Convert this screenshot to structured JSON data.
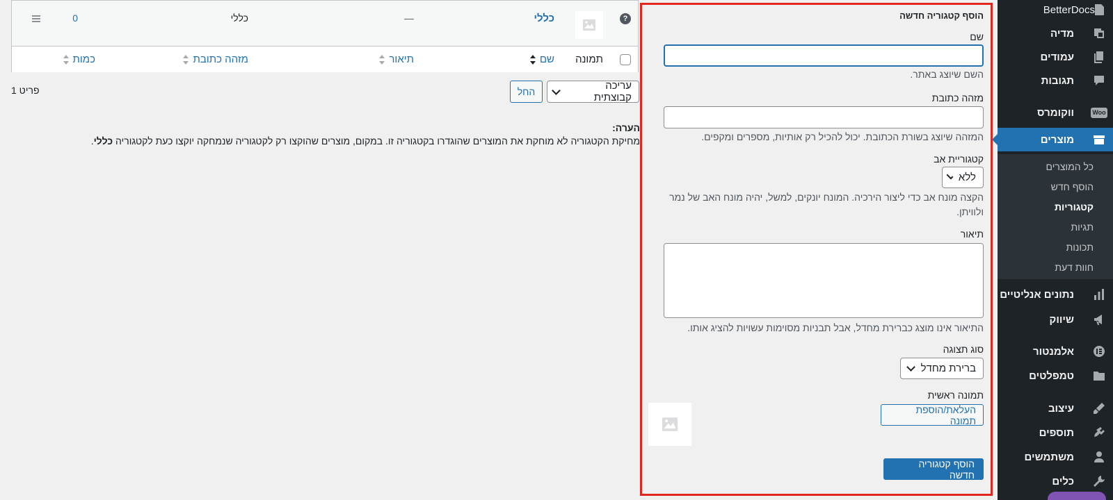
{
  "sidebar": {
    "items": [
      {
        "label": "BetterDocs",
        "icon": "docs-icon"
      },
      {
        "label": "מדיה",
        "icon": "media-icon"
      },
      {
        "label": "עמודים",
        "icon": "pages-icon"
      },
      {
        "label": "תגובות",
        "icon": "comments-icon"
      },
      {
        "label": "ווקומרס",
        "icon": "woocommerce-icon",
        "badge": "Woo"
      },
      {
        "label": "מוצרים",
        "icon": "products-icon",
        "active": true
      },
      {
        "label": "נתונים אנליטיים",
        "icon": "analytics-icon"
      },
      {
        "label": "שיווק",
        "icon": "marketing-icon"
      },
      {
        "label": "אלמנטור",
        "icon": "elementor-icon"
      },
      {
        "label": "טמפלטים",
        "icon": "templates-icon"
      },
      {
        "label": "עיצוב",
        "icon": "appearance-icon"
      },
      {
        "label": "תוספים",
        "icon": "plugins-icon"
      },
      {
        "label": "משתמשים",
        "icon": "users-icon"
      },
      {
        "label": "כלים",
        "icon": "tools-icon"
      }
    ],
    "submenu": [
      {
        "label": "כל המוצרים"
      },
      {
        "label": "הוסף חדש"
      },
      {
        "label": "קטגוריות",
        "current": true
      },
      {
        "label": "תגיות"
      },
      {
        "label": "תכונות"
      },
      {
        "label": "חוות דעת"
      }
    ]
  },
  "form": {
    "title": "הוסף קטגוריה חדשה",
    "name_label": "שם",
    "name_value": "",
    "name_help": "השם שיוצג באתר.",
    "slug_label": "מזהה כתובת",
    "slug_value": "",
    "slug_help": "המזהה שיוצג בשורת הכתובת. יכול להכיל רק אותיות, מספרים ומקפים.",
    "parent_label": "קטגוריית אב",
    "parent_value": "ללא",
    "parent_help_1": "הקצה מונח אב כדי ליצור הירכיה. המונח יונקים, למשל, יהיה מונח האב של נמר",
    "parent_help_2": "ולוויתן.",
    "description_label": "תיאור",
    "description_help": "התיאור אינו מוצג כברירת מחדל, אבל תבניות מסוימות עשויות להציג אותו.",
    "display_type_label": "סוג תצוגה",
    "display_type_value": "ברירת מחדל",
    "thumbnail_label": "תמונה ראשית",
    "upload_button": "העלאת/הוספת תמונה",
    "submit_button": "הוסף קטגוריה חדשה"
  },
  "table": {
    "row": {
      "name": "כללי",
      "description": "—",
      "slug": "כללי",
      "count": "0"
    },
    "headers": {
      "image": "תמונה",
      "name": "שם",
      "description": "תיאור",
      "slug": "מזהה כתובת",
      "count": "כמות"
    }
  },
  "bulk": {
    "action_value": "עריכה קבוצתית",
    "apply_button": "החל",
    "items_count": "פריט 1"
  },
  "note": {
    "title": "הערה:",
    "text_before": "מחיקת הקטגוריה לא מוחקת את המוצרים שהוגדרו בקטגוריה זו. במקום, מוצרים שהוקצו רק לקטגוריה שנמחקה יוקצו כעת לקטגוריה ",
    "bold": "כללי",
    "text_after": "."
  },
  "colors": {
    "accent": "#2271b1",
    "sidebar_bg": "#1d2327",
    "highlight_border": "#e0261d"
  }
}
